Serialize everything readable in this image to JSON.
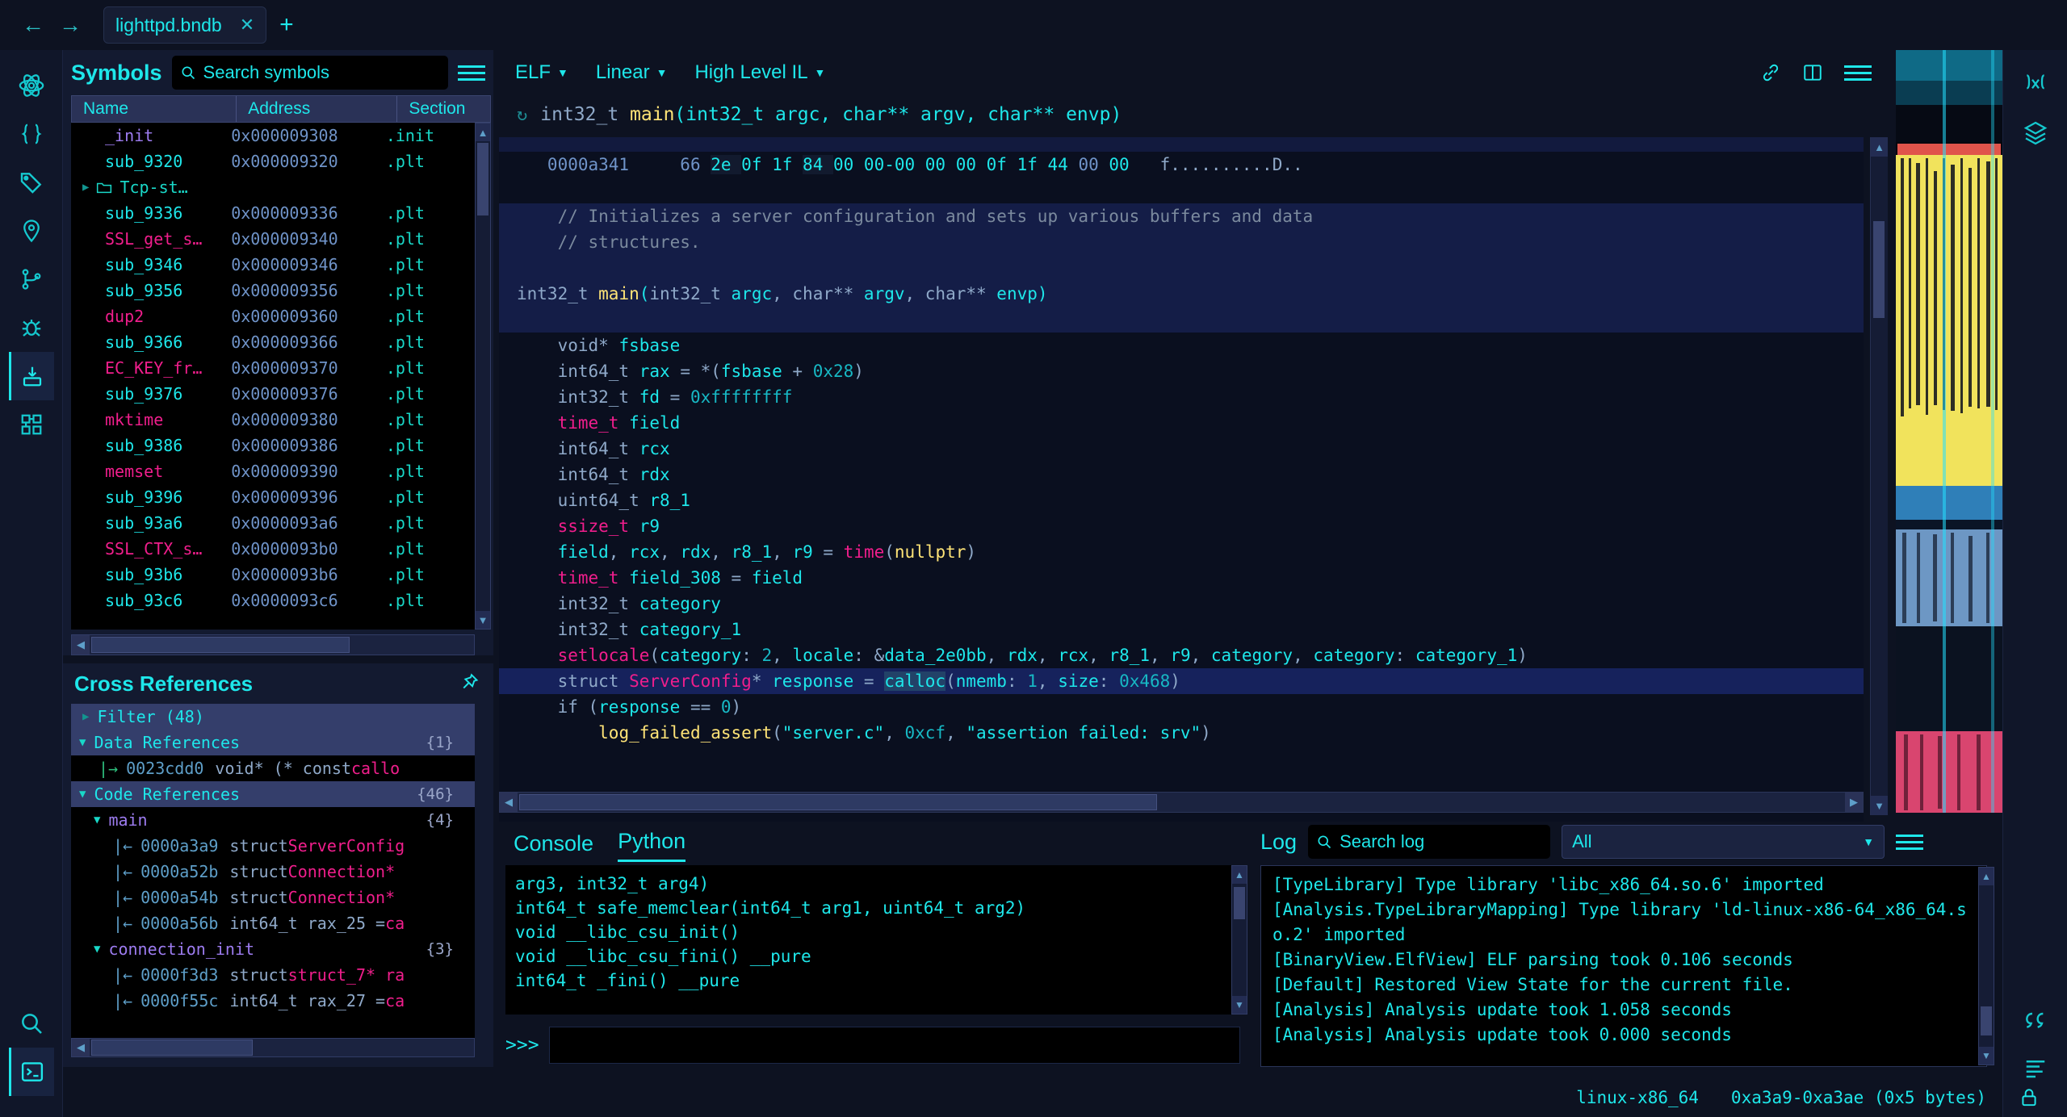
{
  "titlebar": {
    "back_icon": "arrow-left-icon",
    "forward_icon": "arrow-right-icon",
    "tab_title": "lighttpd.bndb",
    "tab_close": "✕",
    "new_tab": "+"
  },
  "symbols": {
    "title": "Symbols",
    "search_placeholder": "Search symbols",
    "columns": [
      "Name",
      "Address",
      "Section"
    ],
    "rows": [
      {
        "name": "_init",
        "addr": "0x000009308",
        "section": ".init",
        "style": "sym-init"
      },
      {
        "name": "sub_9320",
        "addr": "0x000009320",
        "section": ".plt",
        "style": "sym-plt"
      },
      {
        "name": "Tcp-st…",
        "addr": "",
        "section": "",
        "style": "folder"
      },
      {
        "name": "sub_9336",
        "addr": "0x000009336",
        "section": ".plt",
        "style": "sym-plt"
      },
      {
        "name": "SSL_get_s…",
        "addr": "0x000009340",
        "section": ".plt",
        "style": "sym-imp"
      },
      {
        "name": "sub_9346",
        "addr": "0x000009346",
        "section": ".plt",
        "style": "sym-plt"
      },
      {
        "name": "sub_9356",
        "addr": "0x000009356",
        "section": ".plt",
        "style": "sym-plt"
      },
      {
        "name": "dup2",
        "addr": "0x000009360",
        "section": ".plt",
        "style": "sym-imp"
      },
      {
        "name": "sub_9366",
        "addr": "0x000009366",
        "section": ".plt",
        "style": "sym-plt"
      },
      {
        "name": "EC_KEY_fr…",
        "addr": "0x000009370",
        "section": ".plt",
        "style": "sym-imp"
      },
      {
        "name": "sub_9376",
        "addr": "0x000009376",
        "section": ".plt",
        "style": "sym-plt"
      },
      {
        "name": "mktime",
        "addr": "0x000009380",
        "section": ".plt",
        "style": "sym-imp"
      },
      {
        "name": "sub_9386",
        "addr": "0x000009386",
        "section": ".plt",
        "style": "sym-plt"
      },
      {
        "name": "memset",
        "addr": "0x000009390",
        "section": ".plt",
        "style": "sym-imp"
      },
      {
        "name": "sub_9396",
        "addr": "0x000009396",
        "section": ".plt",
        "style": "sym-plt"
      },
      {
        "name": "sub_93a6",
        "addr": "0x0000093a6",
        "section": ".plt",
        "style": "sym-plt"
      },
      {
        "name": "SSL_CTX_s…",
        "addr": "0x0000093b0",
        "section": ".plt",
        "style": "sym-imp"
      },
      {
        "name": "sub_93b6",
        "addr": "0x0000093b6",
        "section": ".plt",
        "style": "sym-plt"
      },
      {
        "name": "sub_93c6",
        "addr": "0x0000093c6",
        "section": ".plt",
        "style": "sym-plt"
      }
    ]
  },
  "xrefs": {
    "title": "Cross References",
    "filter_label": "Filter (48)",
    "groups": [
      {
        "label": "Data References",
        "count": "{1}",
        "items": [
          {
            "dir": "out",
            "addr": "0023cdd0",
            "text": "void* (* const callo",
            "kind": "data"
          }
        ]
      },
      {
        "label": "Code References",
        "count": "{46}",
        "functions": [
          {
            "name": "main",
            "count": "{4}",
            "items": [
              {
                "dir": "in",
                "addr": "0000a3a9",
                "kw": "struct ",
                "ty": "ServerConfig"
              },
              {
                "dir": "in",
                "addr": "0000a52b",
                "kw": "struct ",
                "ty": "Connection*"
              },
              {
                "dir": "in",
                "addr": "0000a54b",
                "kw": "struct ",
                "ty": "Connection*"
              },
              {
                "dir": "in",
                "addr": "0000a56b",
                "kw": "int64_t rax_25 = ",
                "ty": "ca"
              }
            ]
          },
          {
            "name": "connection_init",
            "count": "{3}",
            "items": [
              {
                "dir": "in",
                "addr": "0000f3d3",
                "kw": "struct ",
                "ty": "struct_7* ra"
              },
              {
                "dir": "in",
                "addr": "0000f55c",
                "kw": "int64_t rax_27 = ",
                "ty": "ca"
              }
            ]
          }
        ]
      }
    ]
  },
  "code_toolbar": {
    "format": "ELF",
    "view": "Linear",
    "il": "High Level IL",
    "icons": [
      "link-icon",
      "split-pane-icon",
      "menu-icon"
    ]
  },
  "code": {
    "function_signature_parts": {
      "ret": "int32_t ",
      "name": "main",
      "args": "(int32_t argc, char** argv, char** envp)"
    },
    "hex_line": {
      "address": "0000a341",
      "bytes": [
        "66",
        "2e",
        "0f",
        "1f",
        "84",
        "00",
        "00-00",
        "00",
        "00",
        "0f",
        "1f",
        "44",
        "00",
        "00"
      ],
      "ascii": "f..........D.."
    },
    "comment_lines": [
      "// Initializes a server configuration and sets up various buffers and data",
      "// structures."
    ],
    "signature_line": "int32_t main(int32_t argc, char** argv, char** envp)",
    "body_lines": [
      "void* fsbase",
      "int64_t rax = *(fsbase + 0x28)",
      "int32_t fd = 0xffffffff",
      "time_t field",
      "int64_t rcx",
      "int64_t rdx",
      "uint64_t r8_1",
      "ssize_t r9",
      "field, rcx, rdx, r8_1, r9 = time(nullptr)",
      "time_t field_308 = field",
      "int32_t category",
      "int32_t category_1",
      "setlocale(category: 2, locale: &data_2e0bb, rdx, rcx, r8_1, r9, category, category: category_1)",
      "struct ServerConfig* response = calloc(nmemb: 1, size: 0x468)",
      "if (response == 0)",
      "log_failed_assert(\"server.c\", 0xcf, \"assertion failed: srv\")"
    ]
  },
  "console": {
    "tabs": [
      {
        "label": "Console",
        "active": false
      },
      {
        "label": "Python",
        "active": true
      }
    ],
    "lines": [
      "arg3, int32_t arg4)",
      "int64_t safe_memclear(int64_t arg1, uint64_t arg2)",
      "void __libc_csu_init()",
      "void __libc_csu_fini() __pure",
      "int64_t _fini() __pure"
    ],
    "prompt": ">>>",
    "input_value": ""
  },
  "log": {
    "title": "Log",
    "search_placeholder": "Search log",
    "filter_value": "All",
    "menu_icon": "menu-icon",
    "lines": [
      "[TypeLibrary] Type library 'libc_x86_64.so.6' imported",
      "[Analysis.TypeLibraryMapping] Type library 'ld-linux-x86-64_x86_64.so.2' imported",
      "[BinaryView.ElfView] ELF parsing took 0.106 seconds",
      "[Default] Restored View State for the current file.",
      "[Analysis] Analysis update took 1.058 seconds",
      "[Analysis] Analysis update took 0.000 seconds"
    ]
  },
  "status": {
    "platform": "linux-x86_64",
    "range": "0xa3a9-0xa3ae (0x5 bytes)",
    "lock_icon": "lock-icon"
  },
  "rail_icons": [
    "atom-icon",
    "braces-icon",
    "tag-icon",
    "location-icon",
    "git-branch-icon",
    "bug-icon",
    "import-icon",
    "components-icon"
  ],
  "rail_bottom_icons": [
    "search-icon",
    "terminal-icon"
  ],
  "right_rail_icons": [
    "function-x-icon",
    "layers-icon"
  ],
  "right_rail_bottom_icons": [
    "quote-icon",
    "log-list-icon"
  ],
  "colors": {
    "accent": "#1ee7ea",
    "import": "#f01e8c",
    "address": "#6f93c8",
    "keyword": "#8fa9c9",
    "function": "#ffe477",
    "purple": "#9d7cf0",
    "background": "#0d1221"
  }
}
